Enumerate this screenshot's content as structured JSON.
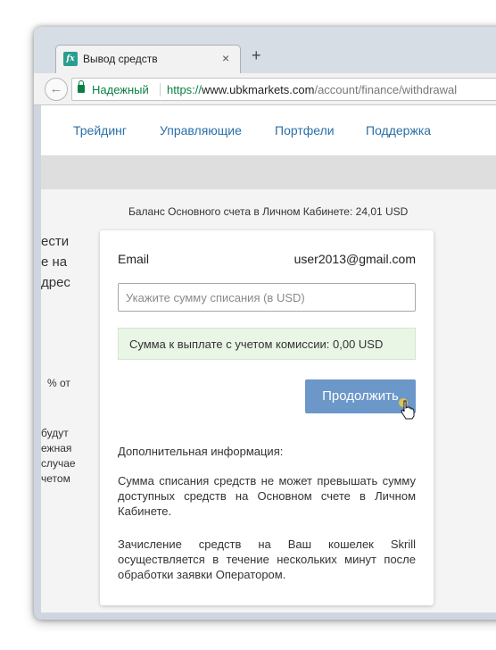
{
  "browser": {
    "tab_title": "Вывод средств",
    "tab_close": "×",
    "new_tab": "+",
    "back_glyph": "←",
    "favicon_text": "fx",
    "secure_label": "Надежный",
    "url_scheme": "https://",
    "url_host": "www.ubkmarkets.com",
    "url_path": "/account/finance/withdrawal"
  },
  "nav": {
    "items": [
      "Трейдинг",
      "Управляющие",
      "Портфели",
      "Поддержка"
    ]
  },
  "balance_text": "Баланс Основного счета в Личном Кабинете: 24,01 USD",
  "side_fragments": [
    "ести",
    "е на",
    "дрес",
    "% от",
    "будут",
    "ежная",
    "случае",
    "четом"
  ],
  "form": {
    "email_label": "Email",
    "email_value": "user2013@gmail.com",
    "amount_placeholder": "Укажите сумму списания (в USD)",
    "commission_text": "Сумма к выплате с учетом комиссии:  0,00 USD",
    "continue_label": "Продолжить"
  },
  "info": {
    "title": "Дополнительная информация:",
    "p1": "Сумма списания средств не может превышать сумму доступных средств на Основном счете в Личном Кабинете.",
    "p2": "Зачисление средств на Ваш кошелек Skrill осуществляется в течение нескольких минут после обработки заявки Оператором."
  },
  "colors": {
    "accent": "#2a6fa8",
    "button": "#6b97c9",
    "secure_green": "#0b8043",
    "commission_bg": "#e9f6e5"
  }
}
